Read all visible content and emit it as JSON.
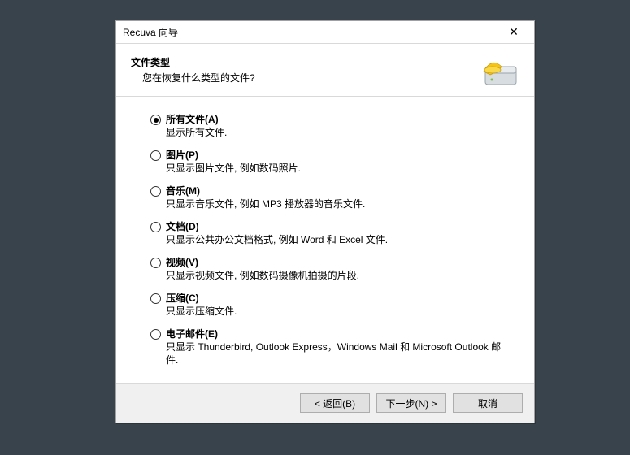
{
  "titlebar": {
    "title": "Recuva 向导",
    "close_glyph": "✕"
  },
  "header": {
    "title": "文件类型",
    "subtitle": "您在恢复什么类型的文件?"
  },
  "options": [
    {
      "label": "所有文件(A)",
      "desc": "显示所有文件.",
      "selected": true
    },
    {
      "label": "图片(P)",
      "desc": "只显示图片文件, 例如数码照片.",
      "selected": false
    },
    {
      "label": "音乐(M)",
      "desc": "只显示音乐文件, 例如 MP3 播放器的音乐文件.",
      "selected": false
    },
    {
      "label": "文档(D)",
      "desc": "只显示公共办公文档格式, 例如 Word 和 Excel 文件.",
      "selected": false
    },
    {
      "label": "视频(V)",
      "desc": "只显示视频文件, 例如数码摄像机拍摄的片段.",
      "selected": false
    },
    {
      "label": "压缩(C)",
      "desc": "只显示压缩文件.",
      "selected": false
    },
    {
      "label": "电子邮件(E)",
      "desc": "只显示 Thunderbird, Outlook Express，Windows Mail 和 Microsoft Outlook 邮件.",
      "selected": false
    }
  ],
  "footer": {
    "back": "< 返回(B)",
    "next": "下一步(N) >",
    "cancel": "取消"
  }
}
